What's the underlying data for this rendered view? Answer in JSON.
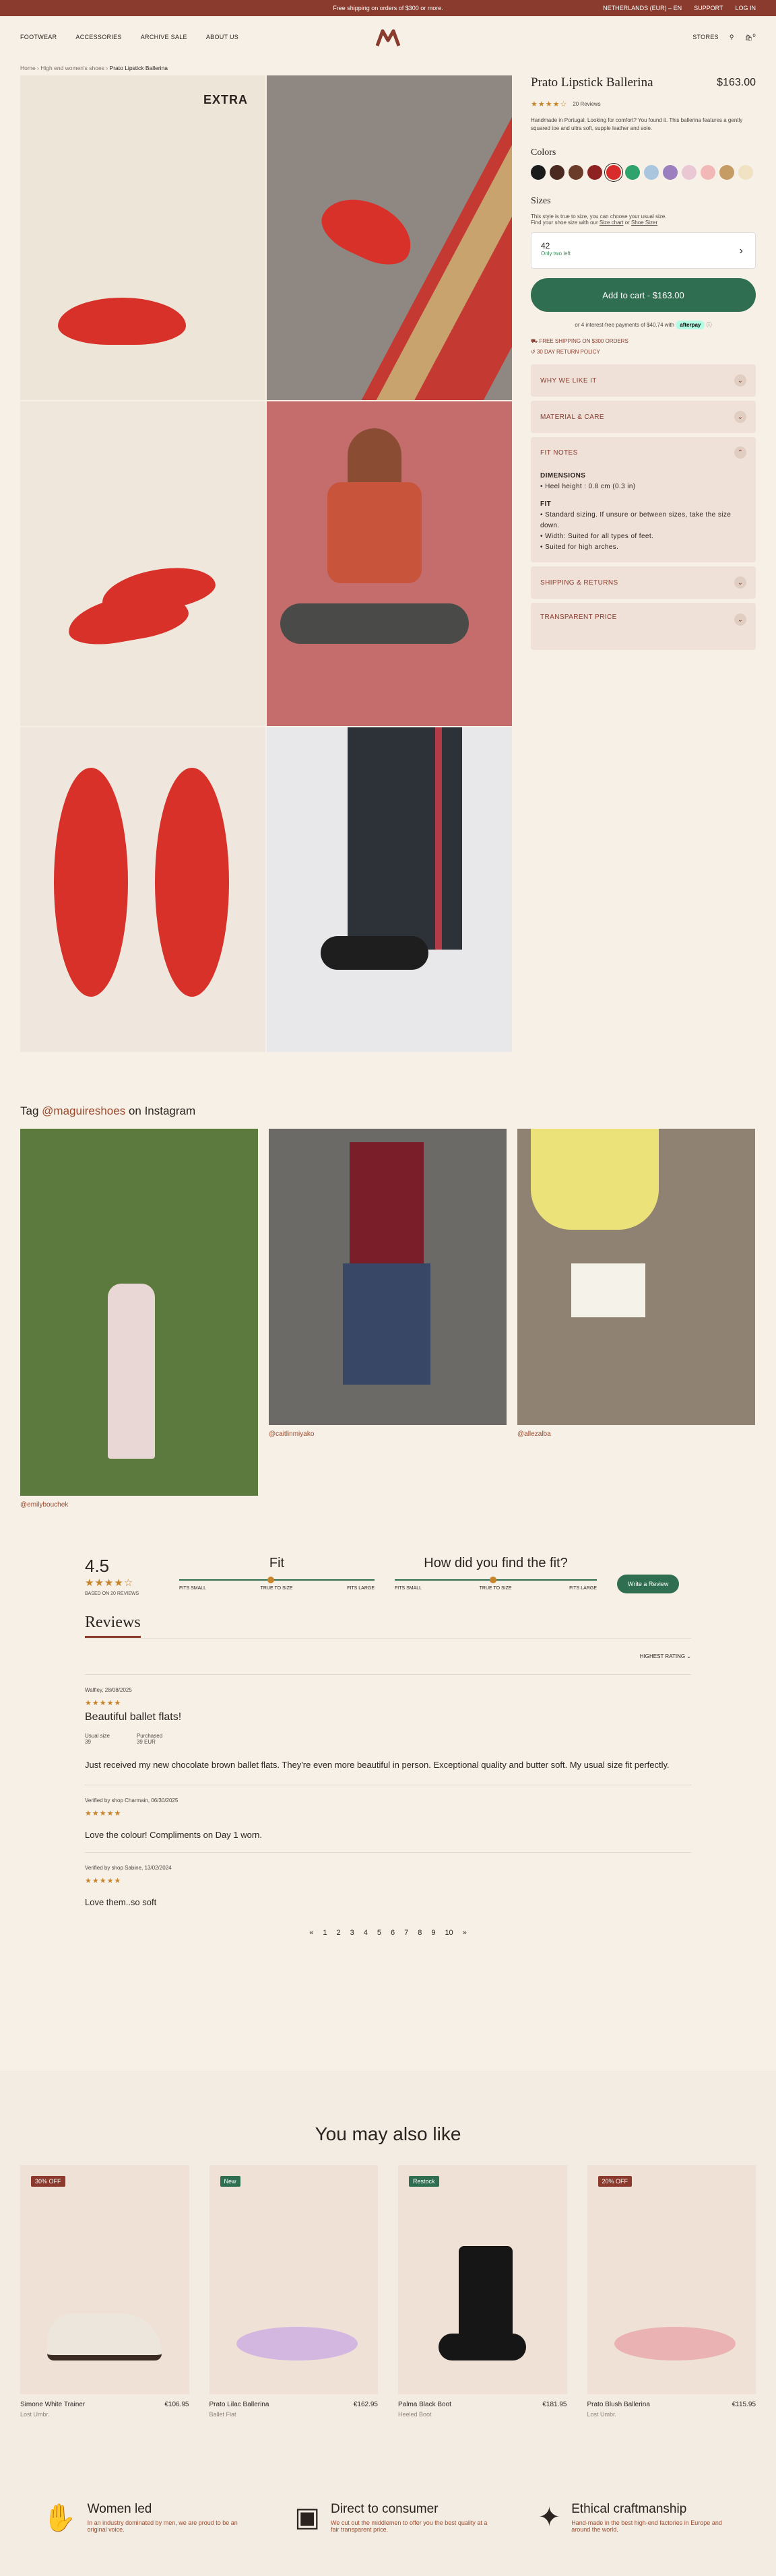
{
  "topbar": {
    "promo": "Free shipping on orders of $300 or more.",
    "region": "NETHERLANDS (EUR) – EN",
    "support": "SUPPORT",
    "login": "LOG IN"
  },
  "nav": {
    "items": [
      "FOOTWEAR",
      "ACCESSORIES",
      "ARCHIVE SALE",
      "ABOUT US"
    ],
    "stores": "STORES",
    "cart_count": "0"
  },
  "breadcrumb": {
    "home": "Home",
    "section": "High end women's shoes",
    "current": "Prato Lipstick Ballerina"
  },
  "product": {
    "title": "Prato Lipstick Ballerina",
    "price": "$163.00",
    "reviews": "20 Reviews",
    "description": "Handmade in Portugal. Looking for comfort? You found it. This ballerina features a gently squared toe and ultra soft, supple leather and sole.",
    "colors_label": "Colors",
    "sizes_label": "Sizes",
    "size_note": "This style is true to size, you can choose your usual size.",
    "size_find": "Find your shoe size with our",
    "size_chart": "Size chart",
    "size_or": "or",
    "shoe_sizer": "Shoe Sizer",
    "selected_size": "42",
    "stock": "Only two left",
    "cart": "Add to cart - $163.00",
    "installments": "or 4 interest-free payments of $40.74 with",
    "afterpay": "afterpay",
    "shipping": "FREE SHIPPING ON $300 ORDERS",
    "returns": "30 DAY RETURN POLICY",
    "accordion": [
      "WHY WE LIKE IT",
      "MATERIAL & CARE",
      "FIT NOTES",
      "SHIPPING & RETURNS",
      "TRANSPARENT PRICE"
    ],
    "fit_dimensions": "DIMENSIONS",
    "heel": "Heel height : 0.8 cm (0.3 in)",
    "fit_title": "FIT",
    "fit_items": [
      "Standard sizing. If unsure or between sizes, take the size down.",
      "Width: Suited for all types of feet.",
      "Suited for high arches."
    ],
    "stamp": "EXTRA"
  },
  "swatches": [
    "#1b1b1b",
    "#4a2a20",
    "#6b3b2a",
    "#8e2222",
    "#d82b2b",
    "#2fa36b",
    "#a9c6de",
    "#9b7fbf",
    "#e9c8d4",
    "#f2b8b8",
    "#c59c63",
    "#f2e2c4"
  ],
  "instagram": {
    "title_pre": "Tag",
    "handle": "@maguireshoes",
    "title_post": "on Instagram",
    "photos": [
      "@emilybouchek",
      "@caitlinmiyako",
      "@allezalba"
    ]
  },
  "reviews": {
    "score": "4.5",
    "based": "BASED ON 20 REVIEWS",
    "fit_title": "Fit",
    "fit_q": "How did you find the fit?",
    "scale": [
      "FITS SMALL",
      "TRUE TO SIZE",
      "FITS LARGE"
    ],
    "write": "Write a Review",
    "heading": "Reviews",
    "sort": "HIGHEST RATING",
    "items": [
      {
        "meta": "Walfley, 28/08/2025",
        "title": "Beautiful ballet flats!",
        "usual_label": "Usual size",
        "usual": "39",
        "purchased_label": "Purchased",
        "purchased": "39 EUR",
        "body": "Just received my new chocolate brown ballet flats. They're even more beautiful in person. Exceptional quality and butter soft. My usual size fit perfectly."
      },
      {
        "meta": "Verified by shop  Charmain, 06/30/2025",
        "title": "",
        "body": "Love the colour! Compliments on Day 1 worn."
      },
      {
        "meta": "Verified by shop  Sabine, 13/02/2024",
        "title": "",
        "body": "Love them..so soft"
      }
    ],
    "pages": [
      "«",
      "1",
      "2",
      "3",
      "4",
      "5",
      "6",
      "7",
      "8",
      "9",
      "10",
      "»"
    ]
  },
  "also": {
    "title": "You may also like",
    "items": [
      {
        "badge": "30% OFF",
        "name": "Simone White Trainer",
        "price": "€106.95",
        "sub": "Lost Umbr."
      },
      {
        "badge": "New",
        "name": "Prato Lilac Ballerina",
        "price": "€162.95",
        "sub": "Ballet Flat"
      },
      {
        "badge": "Restock",
        "name": "Palma Black Boot",
        "price": "€181.95",
        "sub": "Heeled Boot"
      },
      {
        "badge": "20% OFF",
        "name": "Prato Blush Ballerina",
        "price": "€115.95",
        "sub": "Lost Umbr."
      }
    ]
  },
  "features": [
    {
      "title": "Women led",
      "text": "In an industry dominated by men, we are proud to be an original voice."
    },
    {
      "title": "Direct to consumer",
      "text": "We cut out the middlemen to offer you the best quality at a fair transparent price."
    },
    {
      "title": "Ethical craftmanship",
      "text": "Hand-made in the best high-end factories in Europe and around the world."
    }
  ]
}
